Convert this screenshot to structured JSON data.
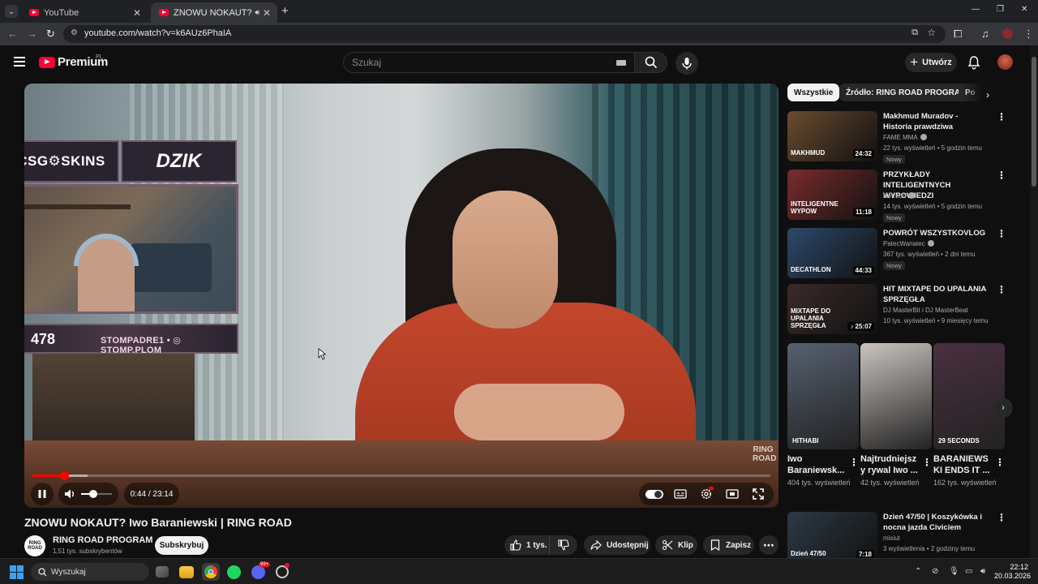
{
  "browser": {
    "tabs": [
      {
        "title": "YouTube",
        "active": false
      },
      {
        "title": "ZNOWU NOKAUT? Iwo Bar",
        "active": true
      }
    ],
    "new_tab": "+",
    "url": "youtube.com/watch?v=k6AUz6PhaIA",
    "window_controls": {
      "minimize": "—",
      "restore": "❐",
      "close": "✕"
    }
  },
  "header": {
    "logo_text": "Premium",
    "logo_country": "PL",
    "search_placeholder": "Szukaj",
    "create_label": "Utwórz"
  },
  "player": {
    "overlay": {
      "sponsor_1": "CSG⚙SKINS",
      "sponsor_2": "DZIK",
      "viewer_count": "478",
      "socials": "STOMPADRE1 • ◎ STOMP.PLOM"
    },
    "watermark": "RING ROAD",
    "time": "0:44 / 23:14",
    "progress_played_fraction": 0.043,
    "progress_buffered_fraction": 0.075,
    "volume_fraction": 0.4
  },
  "video": {
    "title": "ZNOWU NOKAUT? Iwo Baraniewski | RING ROAD",
    "channel_name": "RING ROAD PROGRAM",
    "channel_avatar_text": "RING ROAD",
    "channel_subs": "1,51 tys. subskrybentów",
    "subscribe_label": "Subskrybuj",
    "likes": "1 tys.",
    "share_label": "Udostępnij",
    "clip_label": "Klip",
    "save_label": "Zapisz",
    "more_label": "⋯"
  },
  "sidebar": {
    "chips": [
      "Wszystkie",
      "Źródło: RING ROAD PROGRAM",
      "Po"
    ],
    "recommendations": [
      {
        "title": "Makhmud Muradov - Historia prawdziwa",
        "channel": "FAME MMA",
        "verified": true,
        "meta": "22 tys. wyświetleń • 5 godzin temu",
        "badge": "Nowy",
        "duration": "24:32",
        "thumb_text": "MAKHMUD",
        "thumb_color": "#6b4a2f"
      },
      {
        "title": "PRZYKŁADY INTELIGENTNYCH WYPOWIEDZI",
        "channel": "Herman",
        "verified": true,
        "meta": "14 tys. wyświetleń • 5 godzin temu",
        "badge": "Nowy",
        "duration": "11:18",
        "thumb_text": "INTELIGENTNE WYPOW",
        "thumb_color": "#7a2c2c"
      },
      {
        "title": "POWRÓT WSZYSTKOVLOG",
        "channel": "PatecWariatec",
        "verified": true,
        "meta": "367 tys. wyświetleń • 2 dni temu",
        "badge": "Nowy",
        "duration": "44:33",
        "thumb_text": "DECATHLON",
        "thumb_color": "#2c4a6b"
      },
      {
        "title": "HIT MIXTAPE DO UPALANIA SPRZĘGŁA",
        "channel": "DJ MasterBit i DJ MasterBeat",
        "verified": false,
        "meta": "10 tys. wyświetleń • 9 miesięcy temu",
        "badge": "",
        "duration": "♪ 25:07",
        "thumb_text": "MIXTAPE DO UPALANIA SPRZĘGŁA",
        "thumb_color": "#3a2a2a"
      },
      {
        "title": "Dzień 47/50 | Koszykówka i nocna jazda Civiciem",
        "channel": "misiut",
        "verified": false,
        "meta": "3 wyświetlenia • 2 godziny temu",
        "badge": "",
        "duration": "7:18",
        "thumb_text": "Dzień 47/50",
        "thumb_color": "#2d3a46"
      }
    ],
    "shorts": [
      {
        "title": "Iwo Baraniewsk...",
        "views": "404 tys. wyświetleń",
        "thumb_color": "#556070",
        "thumb_text": "HITHABI"
      },
      {
        "title": "Najtrudniejsz y rywal Iwo ...",
        "views": "42 tys. wyświetleń",
        "thumb_color": "#c9c4bf",
        "thumb_text": ""
      },
      {
        "title": "BARANIEWS KI ENDS IT ...",
        "views": "162 tys. wyświetleń",
        "thumb_color": "#4a3040",
        "thumb_text": "29 SECONDS"
      }
    ]
  },
  "taskbar": {
    "search_label": "Wyszukaj",
    "time": "22:12",
    "date": "20.03.2026",
    "discord_badge": "99+"
  },
  "colors": {
    "accent_red": "#ff0033",
    "background": "#0f0f0f",
    "chip_bg": "#272727"
  }
}
